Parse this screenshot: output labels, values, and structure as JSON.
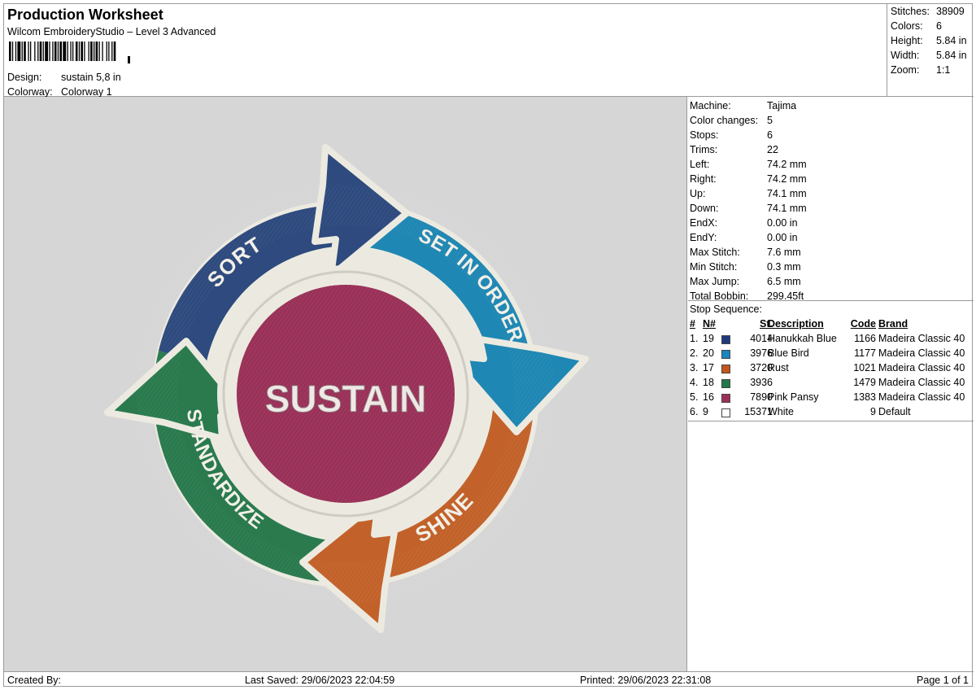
{
  "header": {
    "title": "Production Worksheet",
    "subtitle": "Wilcom EmbroideryStudio – Level 3 Advanced",
    "barcode_icon": "barcode-icon",
    "design_label": "Design:",
    "design_value": "sustain 5,8 in",
    "colorway_label": "Colorway:",
    "colorway_value": "Colorway 1"
  },
  "stats": [
    {
      "label": "Stitches:",
      "value": "38909"
    },
    {
      "label": "Colors:",
      "value": "6"
    },
    {
      "label": "Height:",
      "value": "5.84 in"
    },
    {
      "label": "Width:",
      "value": "5.84 in"
    },
    {
      "label": "Zoom:",
      "value": "1:1"
    }
  ],
  "design": {
    "background": "#d6d6d6",
    "center_text": "SUSTAIN",
    "segments": [
      {
        "label": "SORT",
        "color": "#2e4a7e"
      },
      {
        "label": "SET IN ORDER",
        "color": "#1f87b3"
      },
      {
        "label": "SHINE",
        "color": "#c2622a"
      },
      {
        "label": "STANDARDIZE",
        "color": "#2a7a4e"
      }
    ],
    "center_color": "#9a3158",
    "ring_color": "#eceae0"
  },
  "machine": [
    {
      "label": "Machine:",
      "value": "Tajima"
    },
    {
      "label": "Color changes:",
      "value": "5"
    },
    {
      "label": "Stops:",
      "value": "6"
    },
    {
      "label": "Trims:",
      "value": "22"
    },
    {
      "label": "Left:",
      "value": "74.2 mm"
    },
    {
      "label": "Right:",
      "value": "74.2 mm"
    },
    {
      "label": "Up:",
      "value": "74.1 mm"
    },
    {
      "label": "Down:",
      "value": "74.1 mm"
    },
    {
      "label": "EndX:",
      "value": "0.00 in"
    },
    {
      "label": "EndY:",
      "value": "0.00 in"
    },
    {
      "label": "Max Stitch:",
      "value": "7.6 mm"
    },
    {
      "label": "Min Stitch:",
      "value": "0.3 mm"
    },
    {
      "label": "Max Jump:",
      "value": "6.5 mm"
    },
    {
      "label": "Total Bobbin:",
      "value": "299.45ft"
    }
  ],
  "stop_sequence": {
    "title": "Stop Sequence:",
    "headers": {
      "num": "#",
      "n": "N#",
      "st": "St.",
      "desc": "Description",
      "code": "Code",
      "brand": "Brand"
    },
    "rows": [
      {
        "num": "1.",
        "n": "19",
        "color": "#1f3a7a",
        "st": "4014",
        "desc": "Hanukkah Blue",
        "code": "1166",
        "brand": "Madeira Classic 40"
      },
      {
        "num": "2.",
        "n": "20",
        "color": "#1a86bf",
        "st": "3976",
        "desc": "Blue Bird",
        "code": "1177",
        "brand": "Madeira Classic 40"
      },
      {
        "num": "3.",
        "n": "17",
        "color": "#c2561c",
        "st": "3720",
        "desc": "Rust",
        "code": "1021",
        "brand": "Madeira Classic 40"
      },
      {
        "num": "4.",
        "n": "18",
        "color": "#237a47",
        "st": "3936",
        "desc": "",
        "code": "1479",
        "brand": "Madeira Classic 40"
      },
      {
        "num": "5.",
        "n": "16",
        "color": "#9c2f5a",
        "st": "7890",
        "desc": "Pink Pansy",
        "code": "1383",
        "brand": "Madeira Classic 40"
      },
      {
        "num": "6.",
        "n": "9",
        "color": "#ffffff",
        "st": "15371",
        "desc": "White",
        "code": "9",
        "brand": "Default"
      }
    ]
  },
  "footer": {
    "created_by": "Created By:",
    "last_saved": "Last Saved: 29/06/2023 22:04:59",
    "printed": "Printed: 29/06/2023 22:31:08",
    "page": "Page 1 of 1"
  }
}
